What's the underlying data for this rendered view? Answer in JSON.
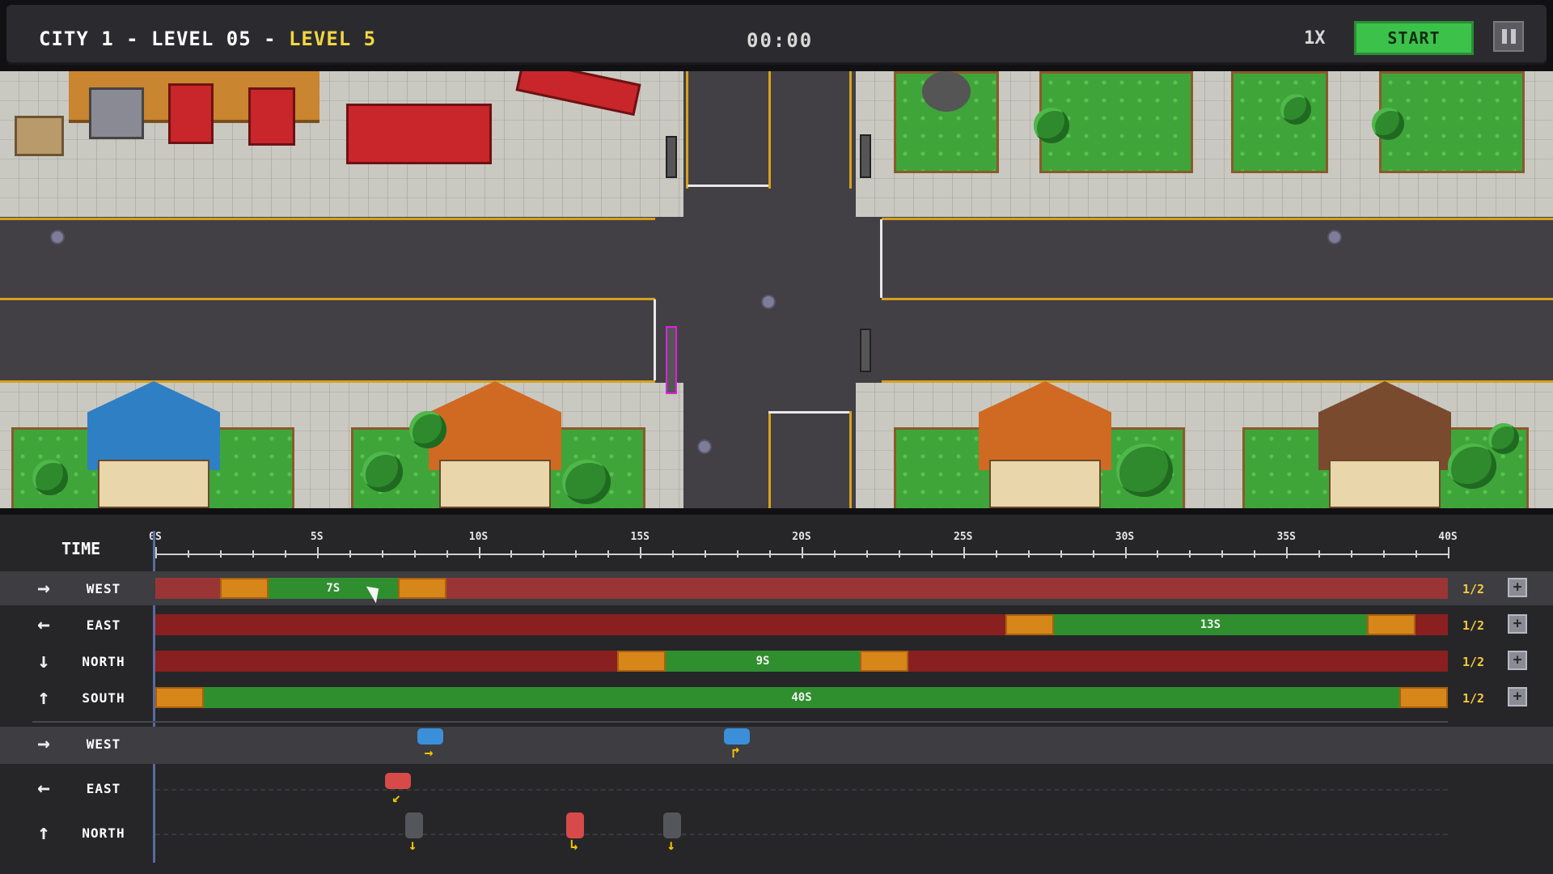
{
  "header": {
    "title_prefix": "CITY 1 - LEVEL 05 - ",
    "title_level": "LEVEL 5",
    "clock": "00:00",
    "speed": "1X",
    "start_label": "START",
    "pause_icon": "pause-icon"
  },
  "timeline": {
    "time_label": "TIME",
    "ruler_ticks": [
      "0S",
      "5S",
      "10S",
      "15S",
      "20S",
      "25S",
      "30S",
      "35S",
      "40S"
    ],
    "max_seconds": 40,
    "signals": [
      {
        "direction": "WEST",
        "icon": "arrow-right-icon",
        "arrow": "→",
        "segments": [
          {
            "amber_start": 2,
            "green_start": 3.5,
            "green_end": 7.5,
            "amber_end": 9,
            "label": "7S"
          }
        ],
        "count": "1/2"
      },
      {
        "direction": "EAST",
        "icon": "arrow-left-icon",
        "arrow": "←",
        "segments": [
          {
            "amber_start": 26.3,
            "green_start": 27.8,
            "green_end": 37.5,
            "amber_end": 39,
            "label": "13S"
          }
        ],
        "count": "1/2"
      },
      {
        "direction": "NORTH",
        "icon": "arrow-down-icon",
        "arrow": "↓",
        "segments": [
          {
            "amber_start": 14.3,
            "green_start": 15.8,
            "green_end": 21.8,
            "amber_end": 23.3,
            "label": "9S"
          }
        ],
        "count": "1/2"
      },
      {
        "direction": "SOUTH",
        "icon": "arrow-up-icon",
        "arrow": "↑",
        "segments": [
          {
            "amber_start": 0,
            "green_start": 1.5,
            "green_end": 38.5,
            "amber_end": 40,
            "label": "40S"
          }
        ],
        "count": "1/2"
      }
    ],
    "add_label": "+",
    "traffic": [
      {
        "direction": "WEST",
        "arrow": "→",
        "cars": [
          {
            "t": 8.5,
            "color": "#3a8fd8",
            "turn": "→"
          },
          {
            "t": 18,
            "color": "#3a8fd8",
            "turn": "↱"
          }
        ]
      },
      {
        "direction": "EAST",
        "arrow": "←",
        "cars": [
          {
            "t": 7.5,
            "color": "#d84a4a",
            "turn": "↙"
          }
        ]
      },
      {
        "direction": "NORTH",
        "arrow": "↑",
        "cars": [
          {
            "t": 8,
            "color": "#55555c",
            "turn": "↓"
          },
          {
            "t": 13,
            "color": "#d84a4a",
            "turn": "↳"
          },
          {
            "t": 16,
            "color": "#55555c",
            "turn": "↓"
          }
        ]
      }
    ]
  }
}
